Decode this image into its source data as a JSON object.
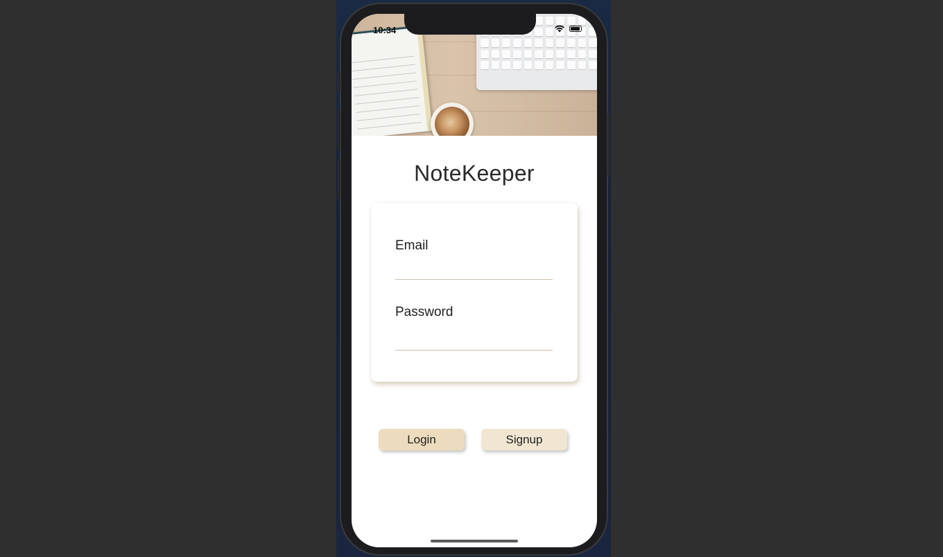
{
  "status_bar": {
    "time": "10:34",
    "wifi_icon": "wifi-icon",
    "battery_icon": "battery-icon"
  },
  "app": {
    "title": "NoteKeeper"
  },
  "form": {
    "email_label": "Email",
    "email_value": "",
    "password_label": "Password",
    "password_value": ""
  },
  "buttons": {
    "login_label": "Login",
    "signup_label": "Signup"
  },
  "colors": {
    "login_bg": "#ecdcbd",
    "signup_bg": "#f1e6d2",
    "text": "#1e1e1e"
  }
}
